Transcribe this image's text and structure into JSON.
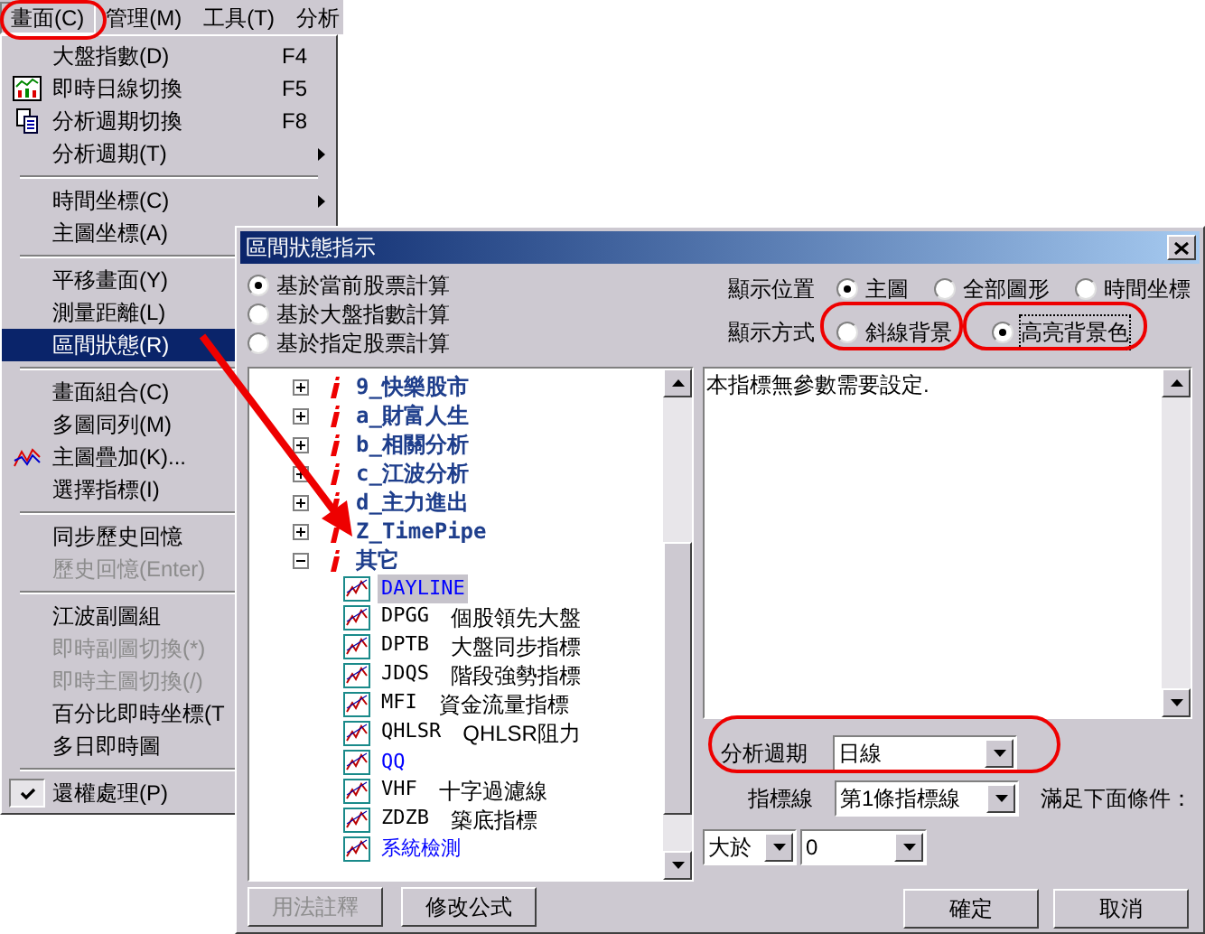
{
  "menubar": [
    {
      "label": "畫面(C)",
      "selected": true
    },
    {
      "label": "管理(M)",
      "selected": false
    },
    {
      "label": "工具(T)",
      "selected": false
    },
    {
      "label": "分析",
      "selected": false
    }
  ],
  "menu": [
    {
      "kind": "item",
      "label": "大盤指數(D)",
      "shortcut": "F4"
    },
    {
      "kind": "item",
      "label": "即時日線切換",
      "shortcut": "F5"
    },
    {
      "kind": "item",
      "label": "分析週期切換",
      "shortcut": "F8"
    },
    {
      "kind": "item",
      "label": "分析週期(T)",
      "submenu": true
    },
    {
      "kind": "separator"
    },
    {
      "kind": "item",
      "label": "時間坐標(C)",
      "submenu": true
    },
    {
      "kind": "item",
      "label": "主圖坐標(A)"
    },
    {
      "kind": "separator"
    },
    {
      "kind": "item",
      "label": "平移畫面(Y)"
    },
    {
      "kind": "item",
      "label": "測量距離(L)"
    },
    {
      "kind": "item",
      "label": "區間狀態(R)",
      "selected": true
    },
    {
      "kind": "separator"
    },
    {
      "kind": "item",
      "label": "畫面組合(C)"
    },
    {
      "kind": "item",
      "label": "多圖同列(M)"
    },
    {
      "kind": "item",
      "label": "主圖疊加(K)..."
    },
    {
      "kind": "item",
      "label": "選擇指標(I)"
    },
    {
      "kind": "separator"
    },
    {
      "kind": "item",
      "label": "同步歷史回憶"
    },
    {
      "kind": "item",
      "label": "歷史回憶(Enter)",
      "disabled": true
    },
    {
      "kind": "separator"
    },
    {
      "kind": "item",
      "label": "江波副圖組"
    },
    {
      "kind": "item",
      "label": "即時副圖切換(*)",
      "disabled": true
    },
    {
      "kind": "item",
      "label": "即時主圖切換(/)",
      "disabled": true
    },
    {
      "kind": "item",
      "label": "百分比即時坐標(T"
    },
    {
      "kind": "item",
      "label": "多日即時圖"
    },
    {
      "kind": "separator"
    },
    {
      "kind": "item",
      "label": "還權處理(P)",
      "checked": true
    }
  ],
  "dialog": {
    "title": "區間狀態指示",
    "basis": [
      {
        "label": "基於當前股票計算",
        "selected": true
      },
      {
        "label": "基於大盤指數計算",
        "selected": false
      },
      {
        "label": "基於指定股票計算",
        "selected": false
      }
    ],
    "position": {
      "label": "顯示位置",
      "options": [
        {
          "label": "主圖",
          "selected": true
        },
        {
          "label": "全部圖形",
          "selected": false
        },
        {
          "label": "時間坐標",
          "selected": false
        }
      ]
    },
    "style": {
      "label": "顯示方式",
      "options": [
        {
          "label": "斜線背景",
          "selected": false
        },
        {
          "label": "高亮背景色",
          "selected": true
        }
      ]
    },
    "tree": [
      {
        "label": "9_快樂股市",
        "expanded": false
      },
      {
        "label": "a_財富人生",
        "expanded": false
      },
      {
        "label": "b_相關分析",
        "expanded": false
      },
      {
        "label": "c_江波分析",
        "expanded": false
      },
      {
        "label": "d_主力進出",
        "expanded": false
      },
      {
        "label": "Z_TimePipe",
        "expanded": false
      },
      {
        "label": "其它",
        "expanded": true,
        "children": [
          {
            "code": "DAYLINE",
            "selected": true,
            "color": "#0000ff"
          },
          {
            "code": "DPGG",
            "name": "個股領先大盤",
            "selected": false,
            "color": "#000000"
          },
          {
            "code": "DPTB",
            "name": "大盤同步指標",
            "selected": false,
            "color": "#000000"
          },
          {
            "code": "JDQS",
            "name": "階段強勢指標",
            "selected": false,
            "color": "#000000"
          },
          {
            "code": "MFI",
            "name": "資金流量指標",
            "selected": false,
            "color": "#000000"
          },
          {
            "code": "QHLSR",
            "name": "QHLSR阻力",
            "selected": false,
            "color": "#000000"
          },
          {
            "code": "QQ",
            "selected": false,
            "color": "#0000ff"
          },
          {
            "code": "VHF",
            "name": "十字過濾線",
            "selected": false,
            "color": "#000000"
          },
          {
            "code": "ZDZB",
            "name": "築底指標",
            "selected": false,
            "color": "#000000"
          },
          {
            "code": "系統檢測",
            "selected": false,
            "color": "#0000ff"
          }
        ]
      }
    ],
    "description": "本指標無參數需要設定.",
    "period": {
      "label": "分析週期",
      "value": "日線"
    },
    "line": {
      "label": "指標線",
      "value": "第1條指標線"
    },
    "condition_label": "滿足下面條件：",
    "operator": "大於",
    "threshold": "0",
    "left_buttons": [
      {
        "label": "用法註釋",
        "disabled": true
      },
      {
        "label": "修改公式",
        "disabled": false
      }
    ],
    "right_buttons": [
      "確定",
      "取消"
    ]
  }
}
